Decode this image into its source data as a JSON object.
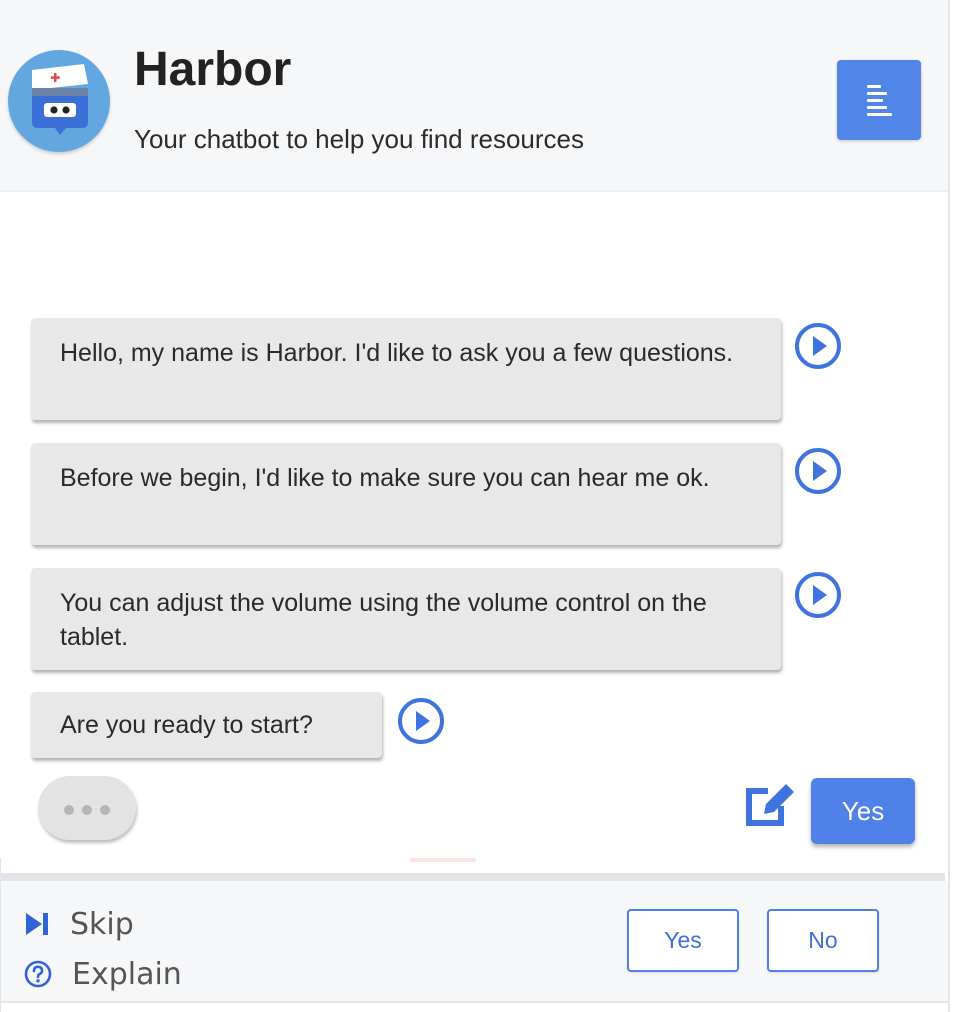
{
  "header": {
    "title": "Harbor",
    "subtitle": "Your chatbot to help you find resources",
    "menu_icon": "menu-lines-icon",
    "avatar_icon": "nurse-robot-icon"
  },
  "messages": [
    {
      "text": "Hello, my name is Harbor. I'd like to ask you a few questions."
    },
    {
      "text": "Before we begin, I'd like to make sure you can hear me ok."
    },
    {
      "text": "You can adjust the volume using the volume control on the tablet."
    },
    {
      "text": "Are you ready to start?"
    }
  ],
  "reply": {
    "edit_icon": "edit-icon",
    "chip_label": "Yes"
  },
  "footer": {
    "skip_label": "Skip",
    "explain_label": "Explain",
    "yes_label": "Yes",
    "no_label": "No"
  },
  "colors": {
    "accent": "#4f81e8",
    "bubble": "#e8e8e8",
    "header_bg": "#f6f7f9"
  }
}
